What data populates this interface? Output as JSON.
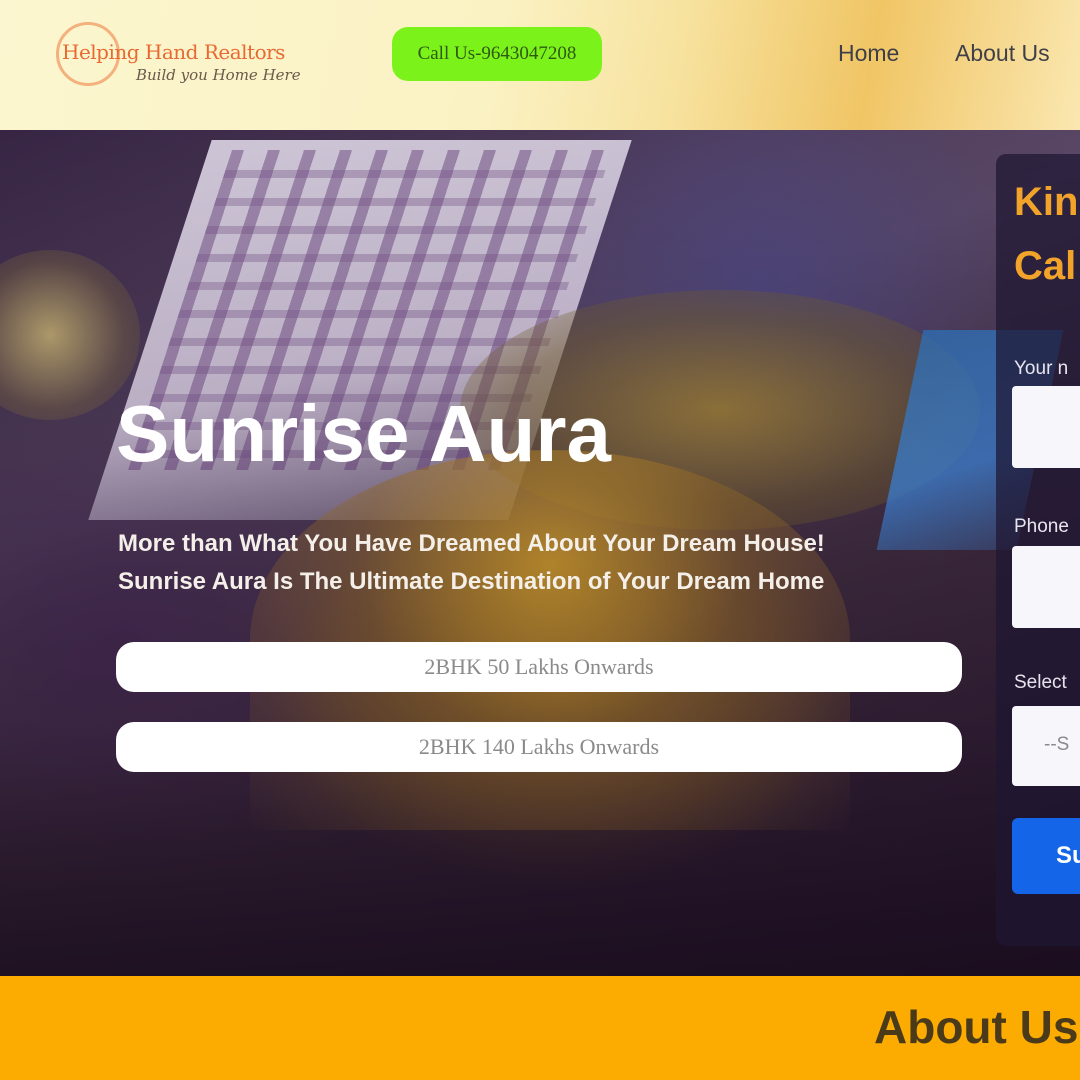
{
  "header": {
    "logo": {
      "name": "Helping Hand Realtors",
      "tagline": "Build you Home Here"
    },
    "call_button": "Call Us-9643047208",
    "nav": {
      "home": "Home",
      "about": "About Us"
    }
  },
  "hero": {
    "title": "Sunrise Aura",
    "subtitle_line1": "More than What You Have Dreamed About Your Dream House!",
    "subtitle_line2": "Sunrise Aura Is The Ultimate Destination of Your Dream Home",
    "price_options": [
      "2BHK 50 Lakhs Onwards",
      "2BHK 140 Lakhs Onwards"
    ]
  },
  "enquiry_panel": {
    "title_line1": "Kin",
    "title_line2": "Cal",
    "name_label": "Your n",
    "phone_label": "Phone",
    "third_label": "Select",
    "select_value": "--S",
    "submit_label": "Su"
  },
  "about_section": {
    "title": "About Us"
  },
  "colors": {
    "call_button": "#7cf21b",
    "about_band": "#fcac00",
    "panel_title": "#f2a42a",
    "submit": "#1565e8"
  }
}
